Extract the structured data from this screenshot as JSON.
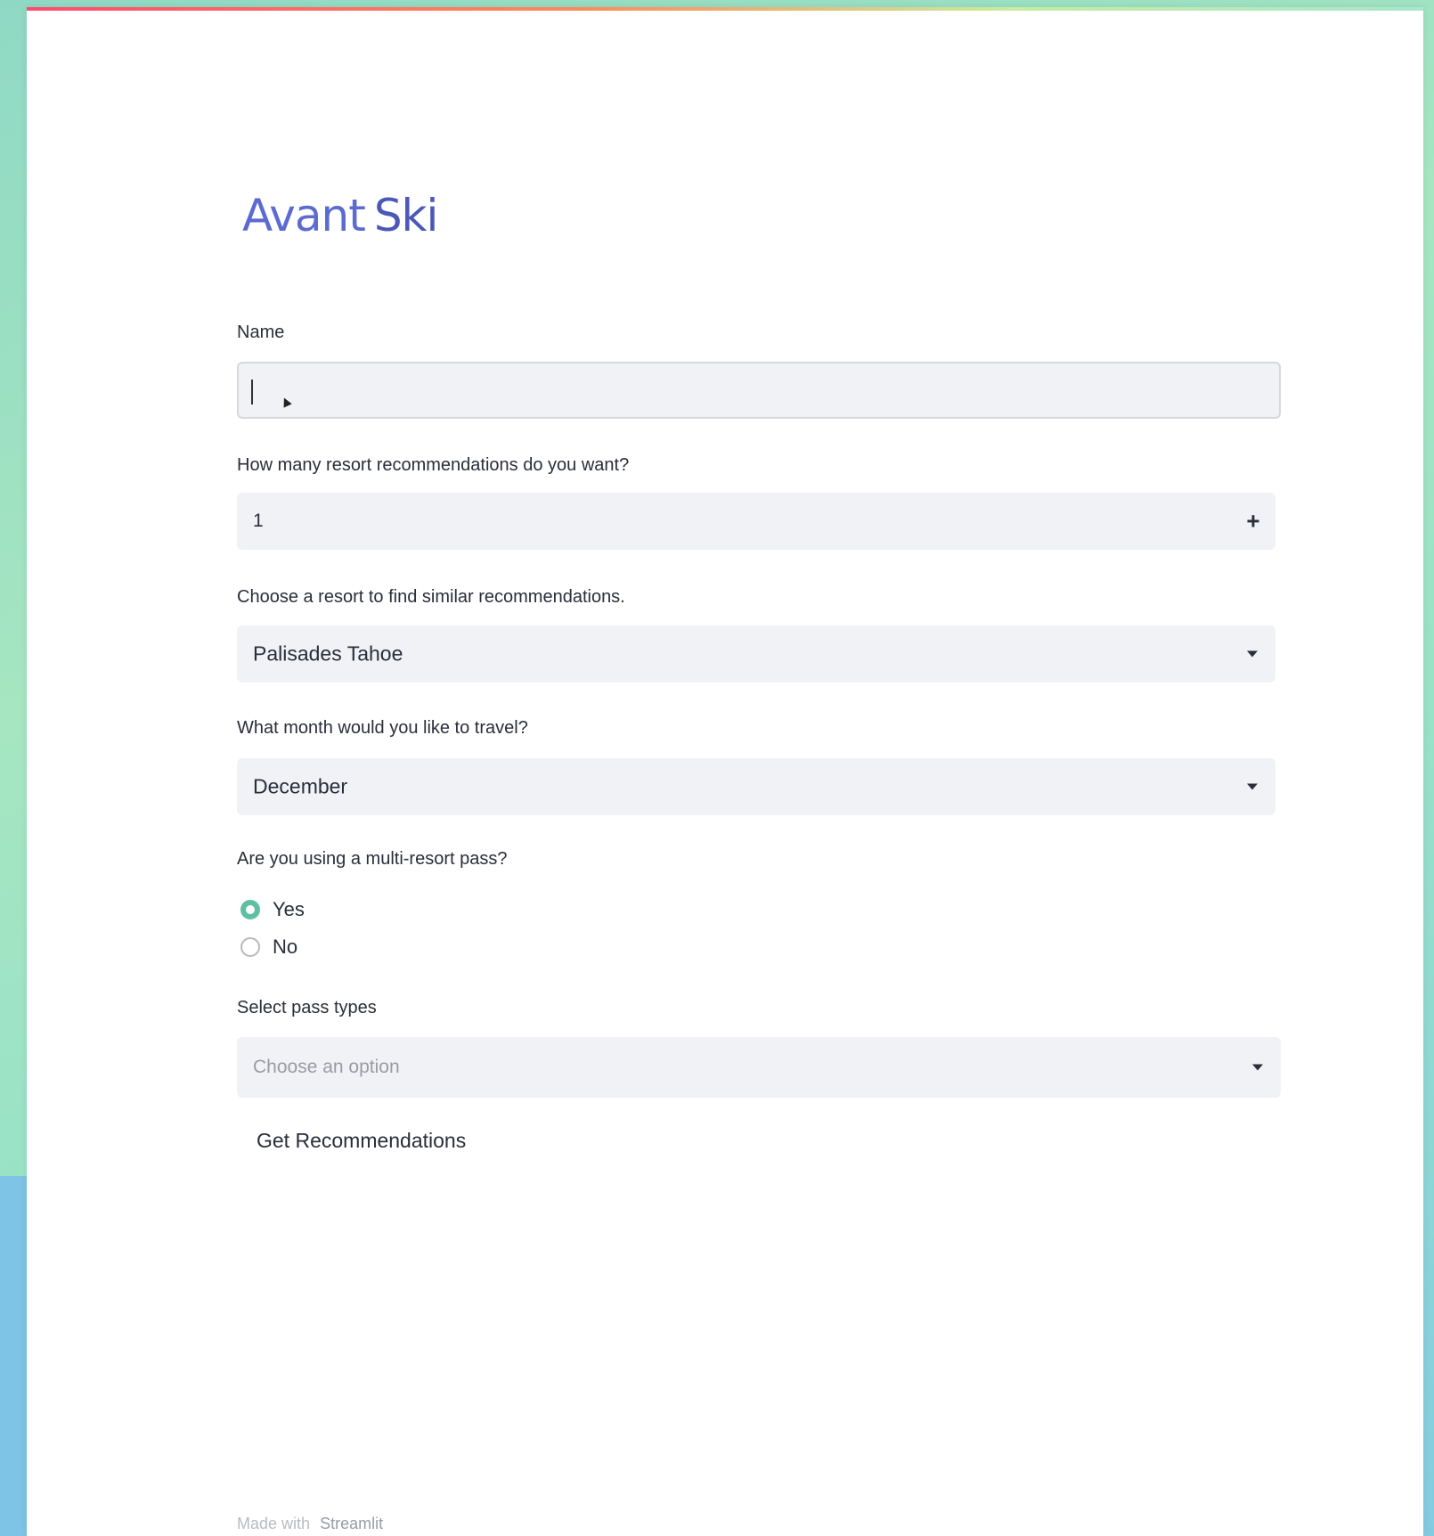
{
  "app": {
    "logo_part1": "Avant",
    "logo_part2": "Ski"
  },
  "form": {
    "name": {
      "label": "Name",
      "value": ""
    },
    "recommendations_count": {
      "label": "How many resort recommendations do you want?",
      "value": "1",
      "increment_symbol": "+"
    },
    "resort": {
      "label": "Choose a resort to find similar recommendations.",
      "value": "Palisades Tahoe"
    },
    "month": {
      "label": "What month would you like to travel?",
      "value": "December"
    },
    "multi_resort_pass": {
      "label": "Are you using a multi-resort pass?",
      "options": [
        "Yes",
        "No"
      ],
      "selected": "Yes"
    },
    "pass_types": {
      "label": "Select pass types",
      "placeholder": "Choose an option"
    },
    "submit_label": "Get Recommendations"
  },
  "footer": {
    "prefix": "Made with",
    "brand": "Streamlit"
  },
  "colors": {
    "accent": "#5fbfa3",
    "logo": "#5b6bd0"
  }
}
